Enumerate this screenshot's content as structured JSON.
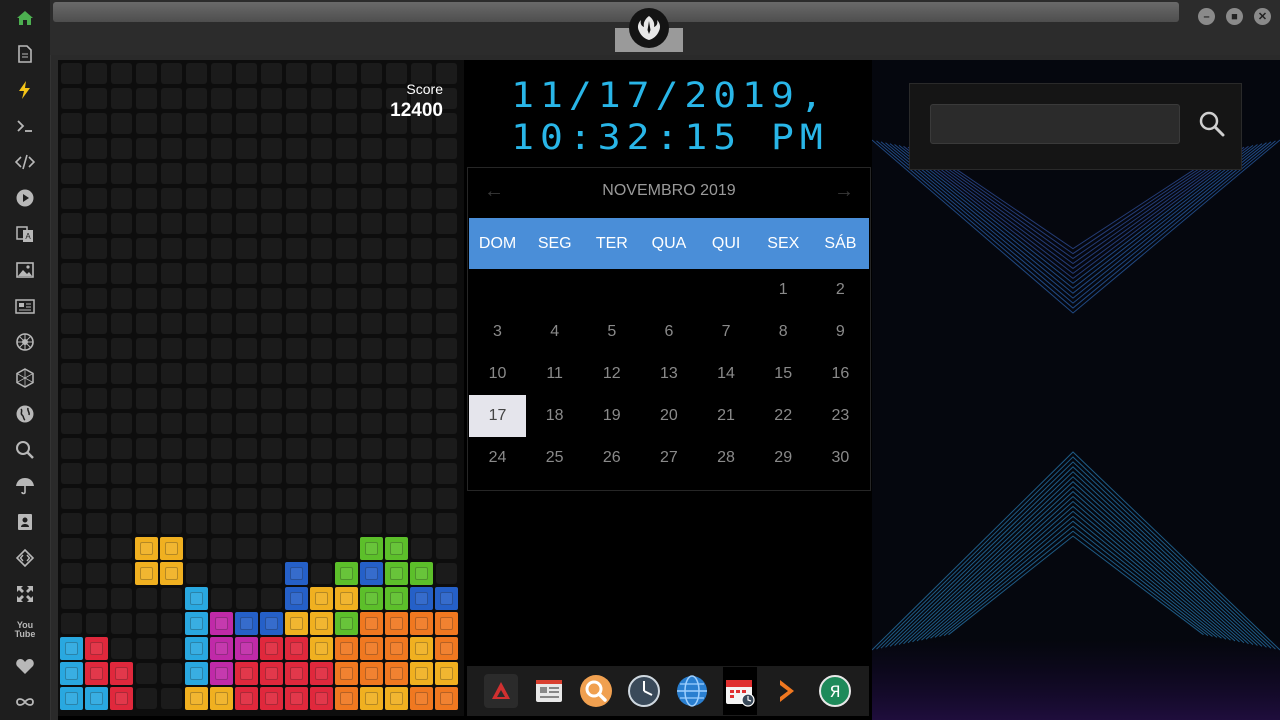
{
  "sidebar": {
    "icons": [
      "home-icon",
      "document-icon",
      "lightning-icon",
      "terminal-icon",
      "code-icon",
      "play-icon",
      "translate-icon",
      "image-icon",
      "news-icon",
      "jedi-icon",
      "hexagon-icon",
      "globe-icon",
      "search-icon",
      "umbrella-icon",
      "contact-card-icon",
      "diamond-code-icon",
      "fullscreen-icon",
      "youtube-icon",
      "heart-icon",
      "infinity-icon"
    ],
    "youtube_label": "You Tube",
    "accent": "#4caf50"
  },
  "tetris": {
    "score_label": "Score",
    "score_value": "12400",
    "colors": {
      "Y": "#f0b020",
      "C": "#29a8e0",
      "B": "#2560c8",
      "G": "#5cbf2a",
      "R": "#e0283c",
      "M": "#c02aa8",
      "O": "#f07820"
    }
  },
  "clock": {
    "date": "11/17/2019,",
    "time": "10:32:15 PM",
    "color": "#29b6e8"
  },
  "calendar": {
    "title": "NOVEMBRO 2019",
    "prev": "←",
    "next": "→",
    "weekdays": [
      "DOM",
      "SEG",
      "TER",
      "QUA",
      "QUI",
      "SEX",
      "SÁB"
    ],
    "first_weekday": 5,
    "days_shown": 30,
    "today": 17,
    "header_color": "#4a8ed8"
  },
  "dock": {
    "apps": [
      "arch-icon",
      "news-reader-icon",
      "search-app-icon",
      "clock-icon",
      "globe-icon",
      "calendar-icon",
      "arrow-icon",
      "yandex-icon"
    ]
  },
  "search": {
    "value": "",
    "placeholder": ""
  }
}
